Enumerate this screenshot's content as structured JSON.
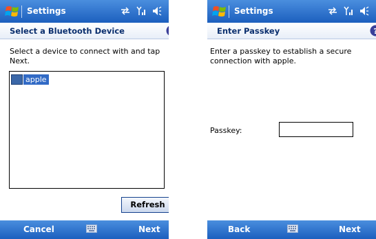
{
  "colors": {
    "title_bar": "#1c5fbe",
    "header_text": "#0b2f6e",
    "selection": "#316ac5"
  },
  "icons": {
    "start": "windows-flag-icon",
    "connectivity": "connectivity-arrows-icon",
    "signal": "signal-strength-icon",
    "volume": "speaker-volume-icon",
    "help": "help-icon",
    "device": "bluetooth-device-icon",
    "keyboard": "input-panel-keyboard-icon"
  },
  "screen1": {
    "title": "Settings",
    "header": "Select a Bluetooth Device",
    "instructions": "Select a device to connect with and tap Next.",
    "devices": [
      {
        "label": "apple",
        "selected": true
      }
    ],
    "refresh_label": "Refresh",
    "left_softkey": "Cancel",
    "right_softkey": "Next"
  },
  "screen2": {
    "title": "Settings",
    "header": "Enter Passkey",
    "instructions": "Enter a passkey to establish a secure connection with apple.",
    "passkey_label": "Passkey:",
    "passkey_value": "",
    "left_softkey": "Back",
    "right_softkey": "Next"
  }
}
